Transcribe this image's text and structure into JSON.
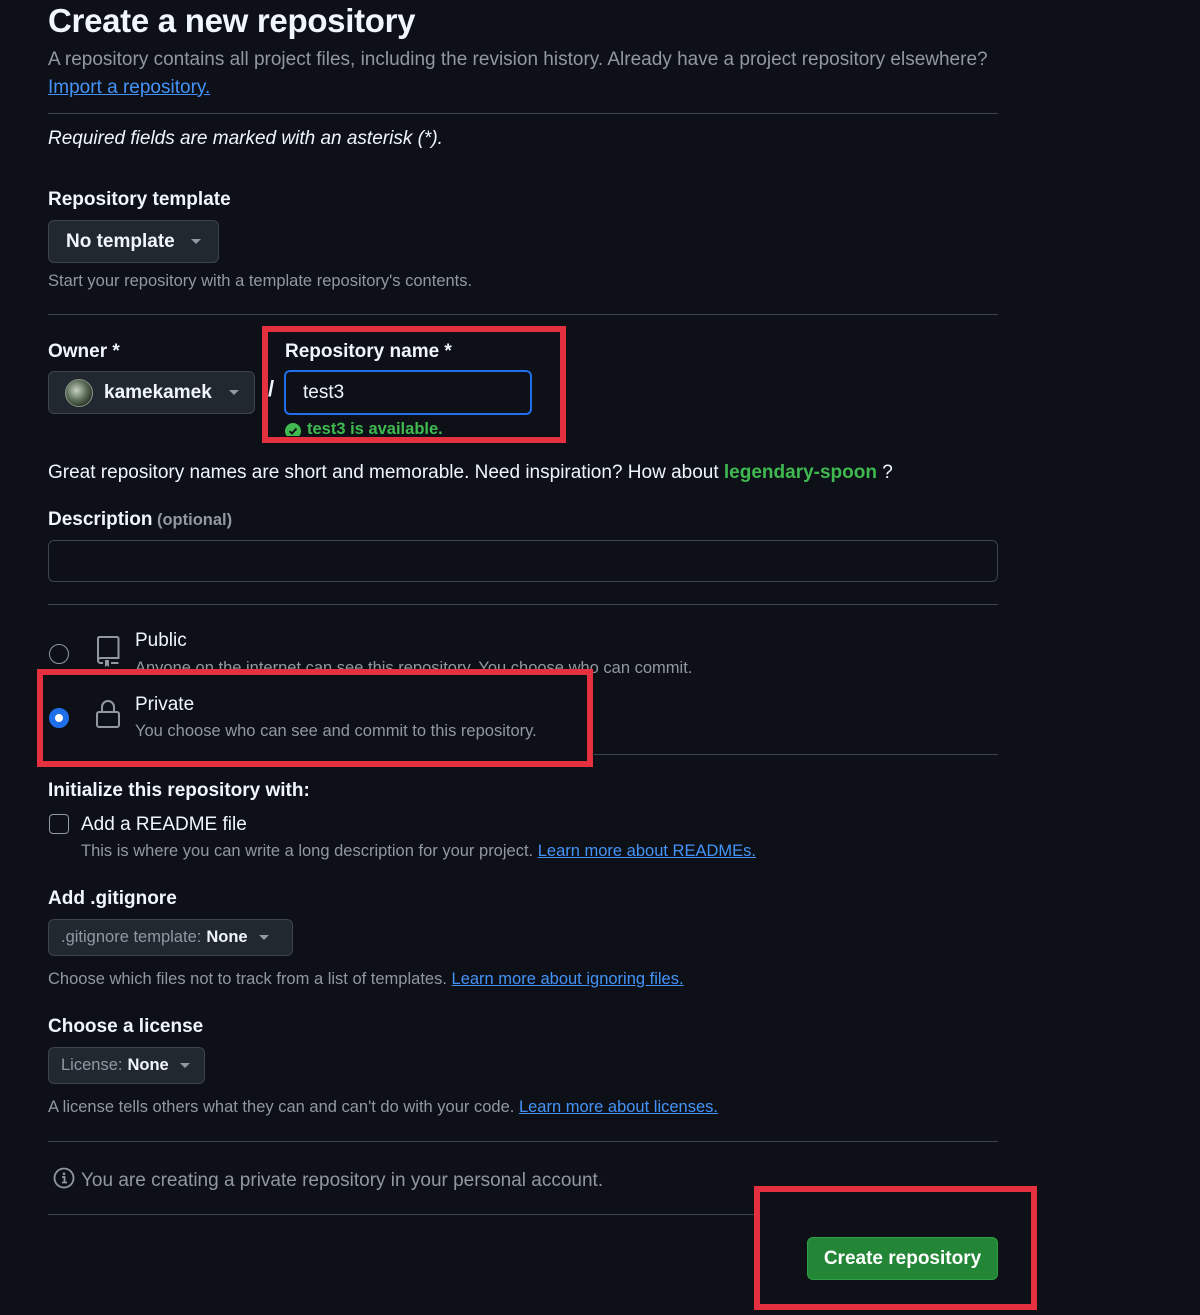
{
  "header": {
    "title": "Create a new repository",
    "subtitle_text": "A repository contains all project files, including the revision history. Already have a project repository elsewhere?",
    "import_link": "Import a repository."
  },
  "required_note": "Required fields are marked with an asterisk (*).",
  "template": {
    "label": "Repository template",
    "button": "No template",
    "hint": "Start your repository with a template repository's contents."
  },
  "owner": {
    "label": "Owner *",
    "value": "kamekamek"
  },
  "separator": "/",
  "repo_name": {
    "label": "Repository name *",
    "value": "test3",
    "availability": "test3 is available."
  },
  "suggestion": {
    "text": "Great repository names are short and memorable. Need inspiration? How about",
    "name": "legendary-spoon",
    "suffix": "?"
  },
  "description": {
    "label": "Description",
    "optional": "(optional)",
    "value": ""
  },
  "visibility": {
    "public": {
      "title": "Public",
      "desc": "Anyone on the internet can see this repository. You choose who can commit."
    },
    "private": {
      "title": "Private",
      "desc": "You choose who can see and commit to this repository.",
      "selected": true
    }
  },
  "initialize": {
    "label": "Initialize this repository with:",
    "readme_label": "Add a README file",
    "readme_desc": "This is where you can write a long description for your project.",
    "readme_link": "Learn more about READMEs."
  },
  "gitignore": {
    "label": "Add .gitignore",
    "button_prefix": ".gitignore template:",
    "button_value": "None",
    "hint": "Choose which files not to track from a list of templates.",
    "link": "Learn more about ignoring files."
  },
  "license": {
    "label": "Choose a license",
    "button_prefix": "License:",
    "button_value": "None",
    "hint": "A license tells others what they can and can't do with your code.",
    "link": "Learn more about licenses."
  },
  "info_text": "You are creating a private repository in your personal account.",
  "submit_label": "Create repository",
  "colors": {
    "background": "#0d1117",
    "accent_blue": "#1f6feb",
    "link": "#4493f8",
    "success_green": "#3fb950",
    "button_green": "#238636",
    "highlight_red": "#e5303f"
  },
  "icons": [
    "caret-down-icon",
    "avatar",
    "check-circle-icon",
    "repo-icon",
    "lock-icon",
    "info-icon"
  ]
}
